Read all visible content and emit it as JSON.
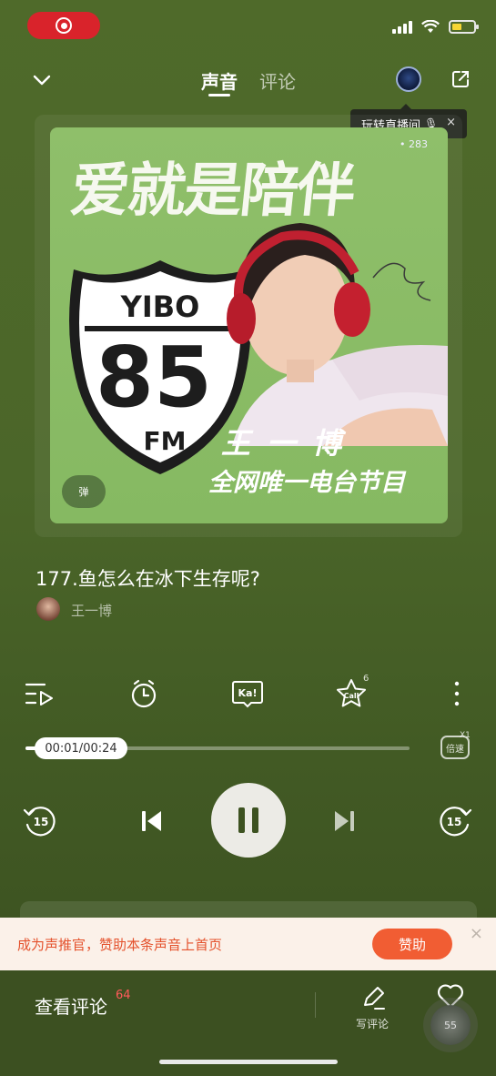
{
  "status_bar": {
    "recording_indicator": "record-icon",
    "signal_icon": "cellular-signal-icon",
    "wifi_icon": "wifi-icon",
    "battery_icon": "battery-icon",
    "battery_level": 0.45,
    "battery_color": "#f6d633"
  },
  "header": {
    "tabs": [
      {
        "label": "声音",
        "active": true
      },
      {
        "label": "评论",
        "active": false
      }
    ],
    "tooltip": {
      "text": "玩转直播间",
      "emoji": "🎙",
      "close": "×"
    }
  },
  "cover": {
    "title": "爱就是陪伴",
    "listen_count": "• 283",
    "shield_top": "YIBO",
    "shield_number": "85",
    "shield_bottom": "FM",
    "name": "王一博",
    "subtitle": "全网唯一电台节目",
    "badge": "弹"
  },
  "track": {
    "title": "177.鱼怎么在冰下生存呢?",
    "artist": "王一博"
  },
  "actions": {
    "playlist_icon": "playlist-icon",
    "timer_icon": "timer-icon",
    "ka_label": "Ka!",
    "call_label": "Call",
    "call_count": "6",
    "more_icon": "more-vertical-icon"
  },
  "progress": {
    "time": "00:01/00:24",
    "fraction": 0.04,
    "speed_label": "倍速",
    "speed_value": "X1"
  },
  "transport": {
    "rewind_label": "15",
    "forward_label": "15"
  },
  "ad": {
    "text": "成为声推官，赞助本条声音上首页",
    "button": "赞助",
    "close": "×",
    "accent": "#f15d33"
  },
  "bottom": {
    "view_comments": "查看评论",
    "comment_count": "64",
    "write_comment": "写评论",
    "like_count": "55"
  },
  "colors": {
    "background": "#4b6629",
    "cover_bg": "#8fbf6a",
    "record_red": "#d9232b"
  }
}
